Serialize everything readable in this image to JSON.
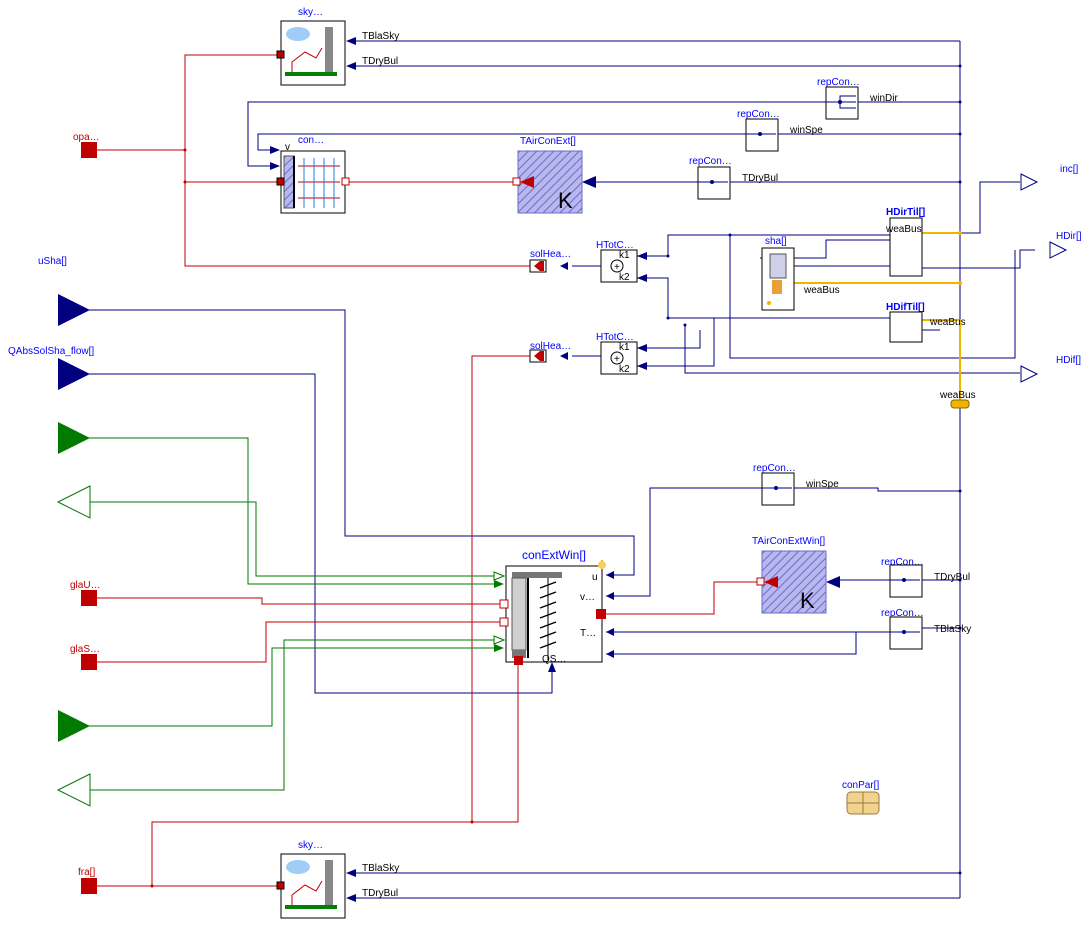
{
  "components": {
    "sky_top": "sky…",
    "sky_bottom": "sky…",
    "con": "con…",
    "con_port_v": "v",
    "tair_con_ext": "TAirConExt[]",
    "tair_con_ext_win": "TAirConExtWin[]",
    "k_letter": "K",
    "rep_con": "repCon…",
    "sol_hea": "solHea…",
    "htot": "HTotC…",
    "k1": "k1",
    "k2": "k2",
    "sha": "sha[]",
    "hdirtil": "HDirTil[]",
    "hdiftil": "HDifTil[]",
    "con_ext_win": "conExtWin[]",
    "cew_port_u": "u",
    "cew_port_v": "v…",
    "cew_port_t": "T…",
    "cew_port_qs": "QS…",
    "con_par": "conPar[]"
  },
  "ports": {
    "opa": "opa…",
    "usha": "uSha[]",
    "qabs": "QAbsSolSha_flow[]",
    "glau": "glaU…",
    "glas": "glaS…",
    "fra": "fra[]",
    "inc": "inc[]",
    "hdir": "HDir[]",
    "hdif": "HDif[]"
  },
  "signals": {
    "tblasky": "TBlaSky",
    "tdrybul": "TDryBul",
    "windir": "winDir",
    "winspe": "winSpe",
    "weabus": "weaBus"
  },
  "colors": {
    "signal_wire": "#000080",
    "heat_wire": "#c00000",
    "real_io": "#007a00",
    "weather_bus": "#f0b400",
    "label": "#0000ff"
  }
}
